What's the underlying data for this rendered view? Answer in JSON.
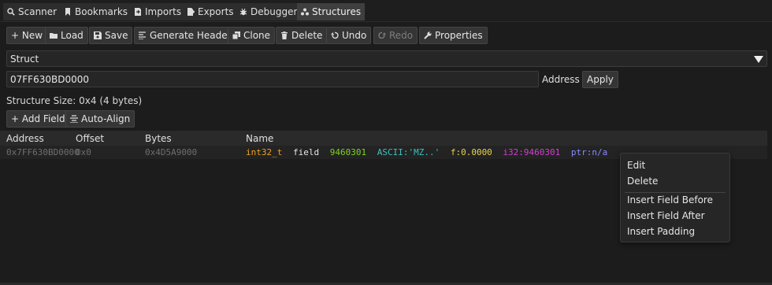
{
  "tabs": [
    {
      "label": "Scanner",
      "icon": "search-icon",
      "active": false
    },
    {
      "label": "Bookmarks",
      "icon": "bookmark-icon",
      "active": false
    },
    {
      "label": "Imports",
      "icon": "imports-icon",
      "active": false
    },
    {
      "label": "Exports",
      "icon": "exports-icon",
      "active": false
    },
    {
      "label": "Debugger",
      "icon": "bug-icon",
      "active": false
    },
    {
      "label": "Structures",
      "icon": "structures-icon",
      "active": true
    }
  ],
  "toolbar": {
    "new_label": "+ New",
    "load_label": "Load",
    "save_label": "Save",
    "generate_header_label": "Generate Header",
    "clone_label": "Clone",
    "delete_label": "Delete",
    "undo_label": "Undo",
    "redo_label": "Redo",
    "properties_label": "Properties"
  },
  "structure": {
    "selected": "Struct",
    "address_value": "07FF630BD0000",
    "address_label": "Address",
    "apply_label": "Apply",
    "size_text": "Structure Size: 0x4 (4 bytes)",
    "add_field_label": "+ Add Field",
    "auto_align_label": "Auto-Align"
  },
  "table": {
    "headers": [
      "Address",
      "Offset",
      "Bytes",
      "Name"
    ],
    "row": {
      "address": "0x7FF630BD0000",
      "offset": "0x0",
      "bytes": "0x4D5A9000",
      "type": "int32_t",
      "field": "field",
      "value": "9460301",
      "ascii": "ASCII:'MZ..'",
      "float": "f:0.0000",
      "i32": "i32:9460301",
      "ptr": "ptr:n/a"
    }
  },
  "context_menu": {
    "items": [
      "Edit",
      "Delete",
      "Insert Field Before",
      "Insert Field After",
      "Insert Padding"
    ]
  },
  "colors": {
    "type": "#f0a020",
    "value": "#7ed321",
    "ascii": "#3fc0c0",
    "float": "#e8d44d",
    "i32": "#d040d0",
    "ptr": "#8a8aff"
  }
}
